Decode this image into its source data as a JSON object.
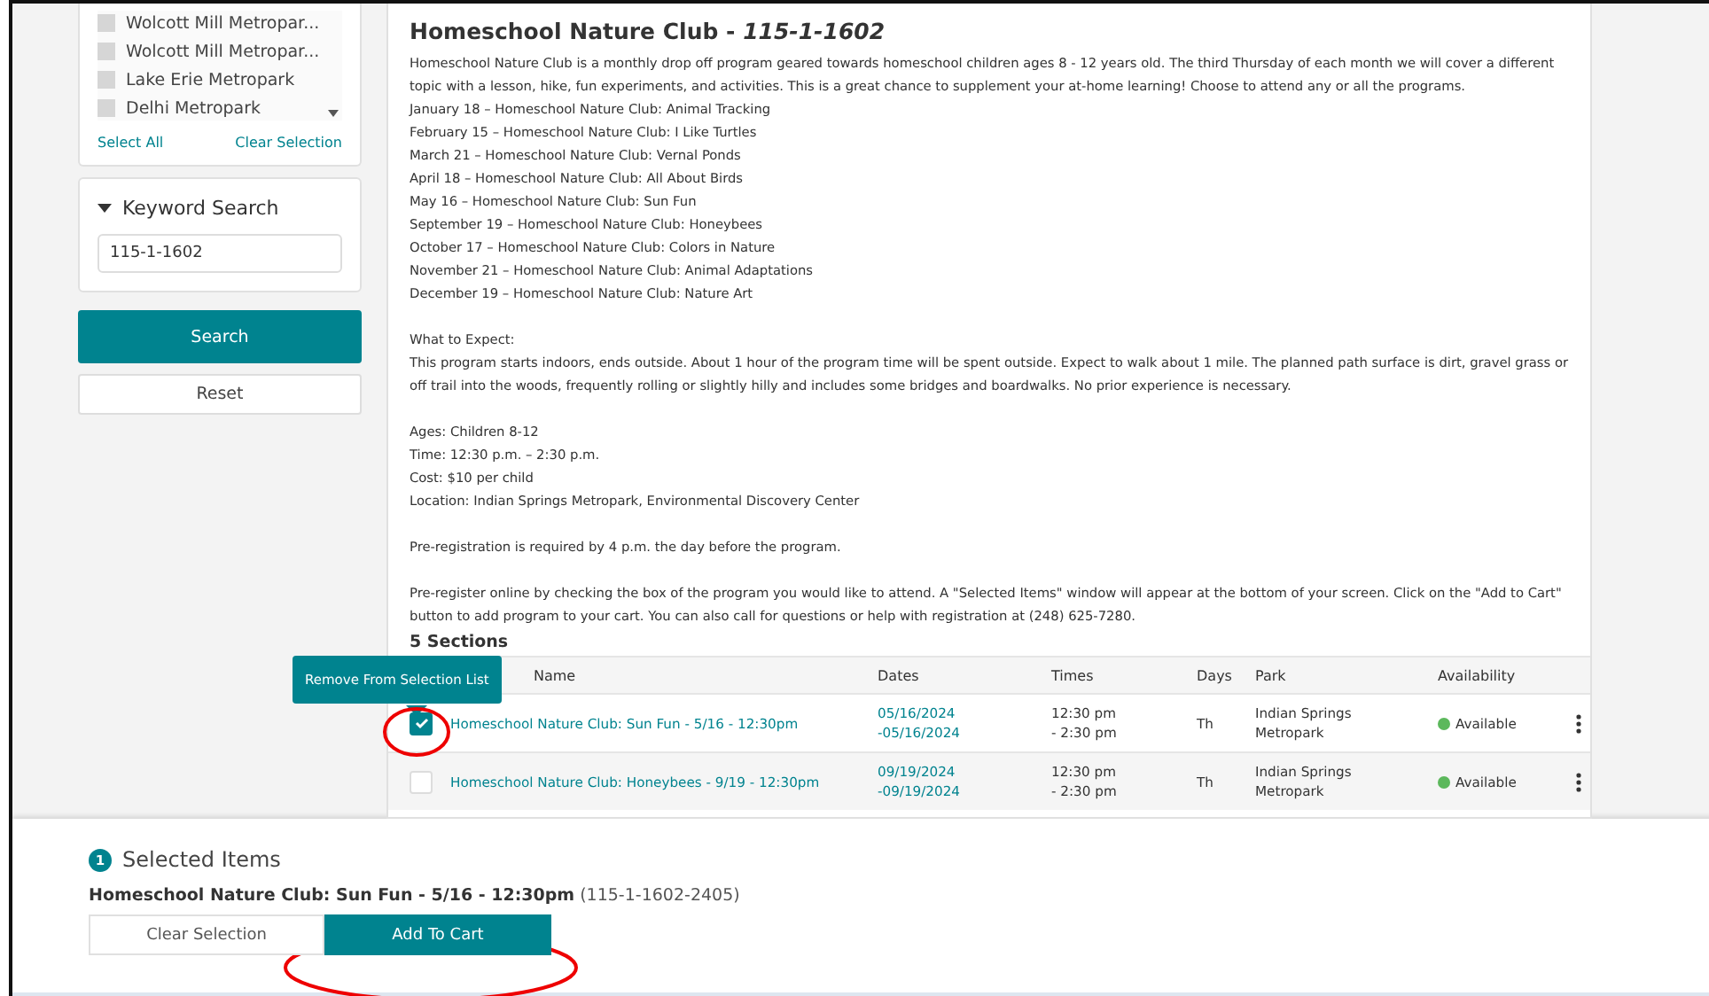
{
  "parks": {
    "items": [
      {
        "label": "Wolcott Mill Metropar...",
        "checked": false
      },
      {
        "label": "Wolcott Mill Metropar...",
        "checked": false
      },
      {
        "label": "Lake Erie Metropark",
        "checked": false
      },
      {
        "label": "Delhi Metropark",
        "checked": false
      }
    ],
    "select_all": "Select All",
    "clear_selection": "Clear Selection"
  },
  "keyword_search": {
    "title": "Keyword Search",
    "expanded": true,
    "value": "115-1-1602"
  },
  "search_button": "Search",
  "reset_button": "Reset",
  "program": {
    "title": "Homeschool Nature Club - ",
    "code": "115-1-1602",
    "blocks": [
      [
        "Homeschool Nature Club is a monthly drop off program geared towards homeschool children ages 8 - 12 years old. The third Thursday of each month we will cover a different topic with a lesson, hike, fun experiments, and activities. This is a great chance to supplement your at-home learning! Choose to attend any or all the programs.",
        "January 18 – Homeschool Nature Club: Animal Tracking",
        "February 15 – Homeschool Nature Club: I Like Turtles",
        "March 21 – Homeschool Nature Club: Vernal Ponds",
        "April 18 – Homeschool Nature Club: All About Birds",
        "May 16 – Homeschool Nature Club: Sun Fun",
        "September 19 – Homeschool Nature Club: Honeybees",
        "October 17 – Homeschool Nature Club: Colors in Nature",
        "November 21 – Homeschool Nature Club: Animal Adaptations",
        "December 19 – Homeschool Nature Club: Nature Art"
      ],
      [
        "What to Expect:",
        "This program starts indoors, ends outside. About 1 hour of the program time will be spent outside. Expect to walk about 1 mile. The planned path surface is dirt, gravel grass or off trail into the woods, frequently rolling or slightly hilly and includes some bridges and boardwalks. No prior experience is necessary."
      ],
      [
        "Ages: Children 8-12",
        "Time: 12:30 p.m. – 2:30 p.m.",
        "Cost: $10 per child",
        "Location: Indian Springs Metropark, Environmental Discovery Center"
      ],
      [
        "Pre-registration is required by 4 p.m. the day before the program."
      ],
      [
        "Pre-register online by checking the box of the program you would like to attend. A \"Selected Items\" window will appear at the bottom of your screen. Click on the \"Add to Cart\" button to add program to your cart. You can also call for questions or help with registration at (248) 625-7280."
      ]
    ],
    "sections_heading": "5 Sections"
  },
  "table": {
    "columns": [
      "Name",
      "Dates",
      "Times",
      "Days",
      "Park",
      "Availability"
    ],
    "rows": [
      {
        "selected": true,
        "name": "Homeschool Nature Club: Sun Fun - 5/16 - 12:30pm",
        "dates": [
          "05/16/2024",
          "-05/16/2024"
        ],
        "times": [
          "12:30 pm",
          "- 2:30 pm"
        ],
        "days": "Th",
        "park": [
          "Indian Springs",
          "Metropark"
        ],
        "availability": "Available",
        "color": "#5cb85c"
      },
      {
        "selected": false,
        "name": "Homeschool Nature Club: Honeybees - 9/19 - 12:30pm",
        "dates": [
          "09/19/2024",
          "-09/19/2024"
        ],
        "times": [
          "12:30 pm",
          "- 2:30 pm"
        ],
        "days": "Th",
        "park": [
          "Indian Springs",
          "Metropark"
        ],
        "availability": "Available",
        "color": "#5cb85c"
      }
    ]
  },
  "tooltip": "Remove From Selection List",
  "selected_items": {
    "count": "1",
    "title": "Selected Items",
    "item": "Homeschool Nature Club: Sun Fun - 5/16 - 12:30pm",
    "item_code": "(115-1-1602-2405)",
    "clear_button": "Clear Selection",
    "add_button": "Add To Cart"
  }
}
